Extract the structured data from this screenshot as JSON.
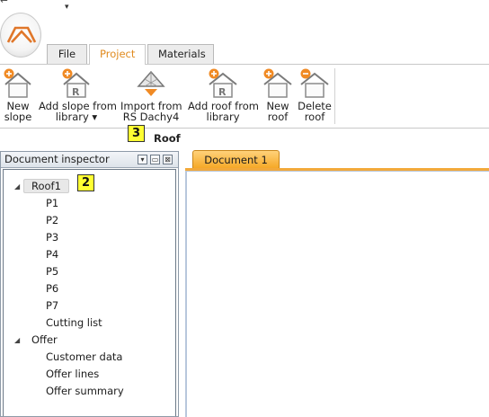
{
  "quick_access": {
    "dropdown_glyph": "▾",
    "corner_glyph": "↩"
  },
  "tabs": [
    {
      "label": "File"
    },
    {
      "label": "Project"
    },
    {
      "label": "Materials"
    }
  ],
  "ribbon": {
    "buttons": [
      {
        "line1": "New",
        "line2": "slope",
        "icon": "add-slope-icon"
      },
      {
        "line1": "Add slope from",
        "line2": "library ▾",
        "icon": "library-slope-icon"
      },
      {
        "line1": "Import from",
        "line2": "RS Dachy4",
        "icon": "import-icon"
      },
      {
        "line1": "Add roof from",
        "line2": "library",
        "icon": "library-roof-icon"
      },
      {
        "line1": "New",
        "line2": "roof",
        "icon": "add-roof-icon"
      },
      {
        "line1": "Delete",
        "line2": "roof",
        "icon": "delete-roof-icon"
      }
    ],
    "group_label": "Roof"
  },
  "badges": {
    "three": "3",
    "two": "2"
  },
  "inspector": {
    "title": "Document inspector",
    "tree": {
      "roof": {
        "label": "Roof1",
        "children": [
          "P1",
          "P2",
          "P3",
          "P4",
          "P5",
          "P6",
          "P7",
          "Cutting list"
        ]
      },
      "offer": {
        "label": "Offer",
        "children": [
          "Customer data",
          "Offer lines",
          "Offer summary"
        ]
      }
    }
  },
  "document_tab": {
    "label": "Document 1"
  },
  "colors": {
    "accent": "#e08a1e",
    "doc_tab": "#f5a623",
    "badge": "#ffff33"
  }
}
